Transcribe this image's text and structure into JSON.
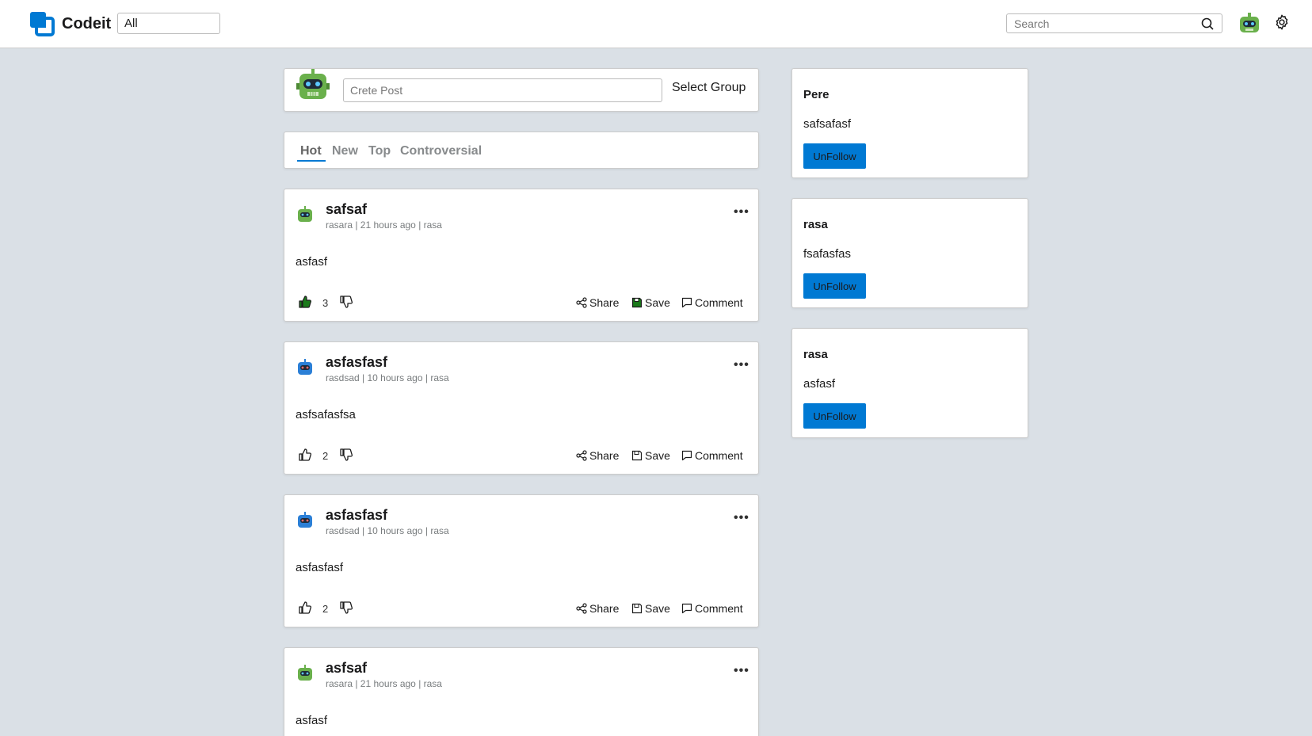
{
  "header": {
    "brand": "Codeit",
    "filter_value": "All",
    "search_placeholder": "Search"
  },
  "create_post": {
    "placeholder": "Crete Post",
    "select_group": "Select Group"
  },
  "sort_tabs": [
    {
      "label": "Hot",
      "active": true
    },
    {
      "label": "New",
      "active": false
    },
    {
      "label": "Top",
      "active": false
    },
    {
      "label": "Controversial",
      "active": false
    }
  ],
  "posts": [
    {
      "title": "safsaf",
      "meta": "rasara | 21 hours ago | rasa",
      "body": "asfasf",
      "votes": "3",
      "upvoted": true,
      "avatar": "green-robot-icon"
    },
    {
      "title": "asfasfasf",
      "meta": "rasdsad | 10 hours ago | rasa",
      "body": "asfsafasfsa",
      "votes": "2",
      "upvoted": false,
      "avatar": "blue-robot-icon"
    },
    {
      "title": "asfasfasf",
      "meta": "rasdsad | 10 hours ago | rasa",
      "body": "asfasfasf",
      "votes": "2",
      "upvoted": false,
      "avatar": "blue-robot-icon"
    },
    {
      "title": "asfsaf",
      "meta": "rasara | 21 hours ago | rasa",
      "body": "asfasf",
      "votes": "",
      "upvoted": false,
      "avatar": "green-robot-icon"
    }
  ],
  "post_actions": {
    "share": "Share",
    "save": "Save",
    "comment": "Comment"
  },
  "groups": [
    {
      "title": "Pere",
      "desc": "safsafasf",
      "button": "UnFollow"
    },
    {
      "title": "rasa",
      "desc": "fsafasfas",
      "button": "UnFollow"
    },
    {
      "title": "rasa",
      "desc": "asfasf",
      "button": "UnFollow"
    }
  ],
  "colors": {
    "accent": "#0079d3",
    "background": "#dae0e6",
    "upvote_active": "#1a7a1a"
  }
}
